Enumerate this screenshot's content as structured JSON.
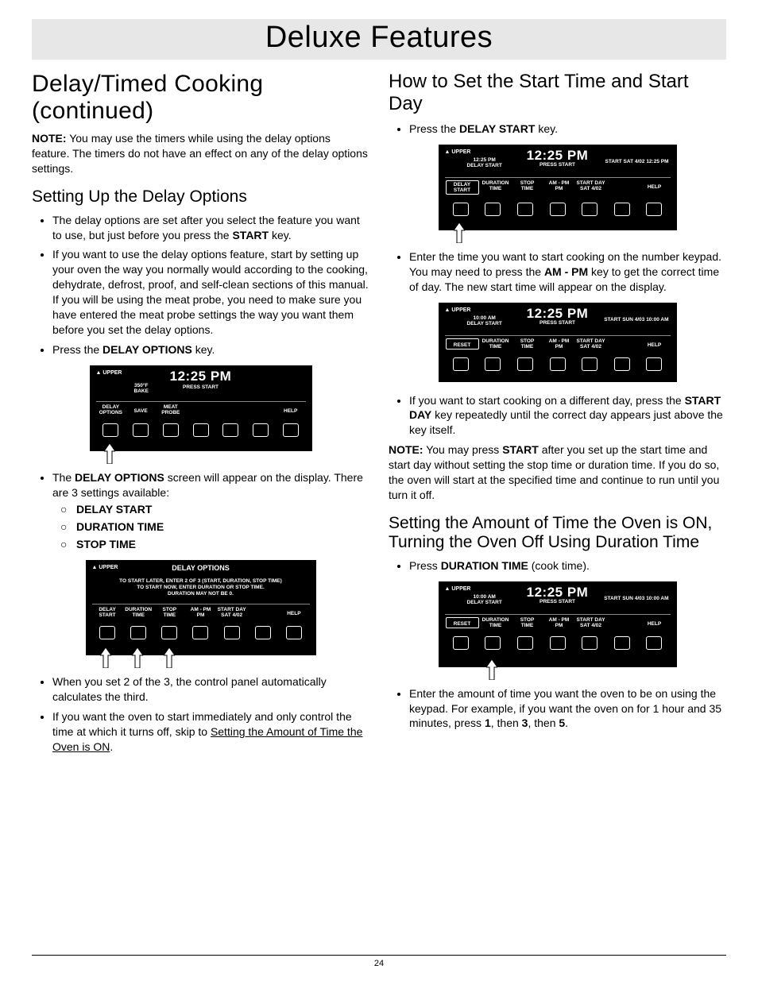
{
  "banner": "Deluxe Features",
  "page_number": "24",
  "left": {
    "h1": "Delay/Timed Cooking (continued)",
    "note_label": "NOTE:",
    "note_text": " You may use the timers while using the delay options feature. The timers do not have an effect on any of the delay options settings.",
    "h2a": "Setting Up the Delay Options",
    "b1_a": "The delay options are set after you select the feature you want to use, but just before you press the ",
    "b1_b": "START",
    "b1_c": " key.",
    "b2": "If you want to use the delay options feature, start by setting up your oven the way you normally would according to the cooking, dehydrate, defrost, proof, and self-clean sections of this manual. If you will be using the meat probe, you need to make sure you have entered the meat probe settings the way you want them before you set the delay options.",
    "b3_a": "Press the ",
    "b3_b": "DELAY OPTIONS",
    "b3_c": " key.",
    "b4_a": "The ",
    "b4_b": "DELAY OPTIONS",
    "b4_c": " screen will appear on the display. There are 3 settings available:",
    "sub1": "DELAY START",
    "sub2": "DURATION TIME",
    "sub3": "STOP TIME",
    "b5": "When you set 2 of the 3, the control panel automatically calculates the third.",
    "b6_a": "If you want the oven to start immediately and only control the time at which it turns off, skip to ",
    "b6_b": "Setting the Amount of Time the Oven is ON",
    "b6_c": "."
  },
  "right": {
    "h2a": "How to Set the Start Time and Start Day",
    "b1_a": "Press the ",
    "b1_b": "DELAY START",
    "b1_c": " key.",
    "b2_a": "Enter the time you want to start cooking on the number keypad. You may need to press the ",
    "b2_b": "AM - PM",
    "b2_c": " key to get the correct time of day. The new start time will appear on the display.",
    "b3_a": "If you want to start cooking on a different day, press the ",
    "b3_b": "START DAY",
    "b3_c": " key repeatedly until the correct day appears just above the key itself.",
    "note_label": "NOTE:",
    "note_a": " You may press ",
    "note_b": "START",
    "note_c": " after you set up the start time and start day without setting the stop time or duration time. If you do so, the oven will start at the specified time and continue to run until you turn it off.",
    "h2b": "Setting the Amount of Time the Oven is ON, Turning the Oven Off Using Duration Time",
    "b4_a": "Press ",
    "b4_b": "DURATION TIME",
    "b4_c": " (cook time).",
    "b5_a": "Enter the amount of time you want the oven to be on using the keypad. For example, if you want the oven on for 1 hour and 35 minutes, press ",
    "b5_b": "1",
    "b5_c": ", then ",
    "b5_d": "3",
    "b5_e": ", then ",
    "b5_f": "5",
    "b5_g": "."
  },
  "panels": {
    "common": {
      "upper": "UPPER",
      "help": "HELP",
      "press_start": "PRESS START"
    },
    "p1": {
      "clock": "12:25 PM",
      "bake_temp": "350°F",
      "bake_lbl": "BAKE",
      "labels": [
        "DELAY\nOPTIONS",
        "SAVE",
        "MEAT\nPROBE",
        "",
        "",
        "",
        "HELP"
      ]
    },
    "p2": {
      "title": "DELAY OPTIONS",
      "instr1": "TO START LATER, ENTER 2 OF 3 (START, DURATION, STOP TIME)",
      "instr2": "TO START NOW, ENTER DURATION OR STOP TIME.",
      "instr3": "DURATION MAY NOT BE 0.",
      "labels": [
        "DELAY\nSTART",
        "DURATION\nTIME",
        "STOP\nTIME",
        "AM - PM\nPM",
        "START DAY\nSAT 4/02",
        "",
        "HELP"
      ]
    },
    "p3": {
      "clock": "12:25 PM",
      "sub_time": "12:25 PM",
      "sub_lbl": "DELAY START",
      "topright": "START SAT 4/02 12:25 PM",
      "labels": [
        "DELAY\nSTART",
        "DURATION\nTIME",
        "STOP\nTIME",
        "AM - PM\nPM",
        "START DAY\nSAT 4/02",
        "",
        "HELP"
      ]
    },
    "p4": {
      "clock": "12:25 PM",
      "sub_time": "10:00 AM",
      "sub_lbl": "DELAY START",
      "topright": "START SUN 4/03 10:00 AM",
      "labels": [
        "RESET",
        "DURATION\nTIME",
        "STOP\nTIME",
        "AM - PM\nPM",
        "START DAY\nSAT 4/02",
        "",
        "HELP"
      ]
    },
    "p5": {
      "clock": "12:25 PM",
      "sub_time": "10:00 AM",
      "sub_lbl": "DELAY START",
      "topright": "START SUN 4/03 10:00 AM",
      "labels": [
        "RESET",
        "DURATION\nTIME",
        "STOP\nTIME",
        "AM - PM\nPM",
        "START DAY\nSAT 4/02",
        "",
        "HELP"
      ]
    }
  }
}
